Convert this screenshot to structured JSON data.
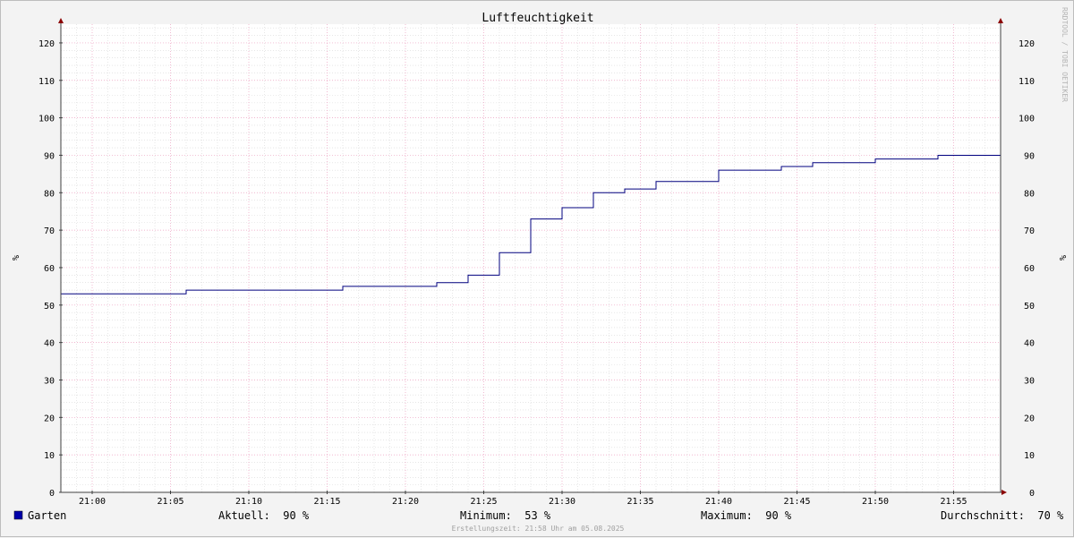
{
  "chart_data": {
    "type": "line",
    "title": "Luftfeuchtigkeit",
    "ylabel_left": "%",
    "ylabel_right": "%",
    "ylim": [
      0,
      125
    ],
    "y_major_ticks": [
      0,
      10,
      20,
      30,
      40,
      50,
      60,
      70,
      80,
      90,
      100,
      110,
      120
    ],
    "x_tick_labels": [
      "21:00",
      "21:05",
      "21:10",
      "21:15",
      "21:20",
      "21:25",
      "21:30",
      "21:35",
      "21:40",
      "21:45",
      "21:50",
      "21:55"
    ],
    "x_range": [
      "20:58",
      "21:58"
    ],
    "step": true,
    "grid": true,
    "colors": {
      "line": "#00007f",
      "legend_box": "#0000aa",
      "grid_minor": "#d8d8d8",
      "grid_major": "#ec9ebf",
      "axis": "#404040",
      "arrow": "#8b0000"
    },
    "series": [
      {
        "name": "Garten",
        "x": [
          "20:58",
          "21:06",
          "21:16",
          "21:22",
          "21:24",
          "21:26",
          "21:28",
          "21:30",
          "21:32",
          "21:34",
          "21:36",
          "21:40",
          "21:44",
          "21:46",
          "21:50",
          "21:54",
          "21:58"
        ],
        "values": [
          53,
          54,
          55,
          56,
          58,
          64,
          73,
          76,
          80,
          81,
          83,
          86,
          87,
          88,
          89,
          90,
          90
        ]
      }
    ]
  },
  "legend": {
    "series_label": "Garten",
    "current": "Aktuell:  90 %",
    "minimum": "Minimum:  53 %",
    "maximum": "Maximum:  90 %",
    "average": "Durchschnitt:  70 %"
  },
  "footer": "Erstellungszeit: 21:58 Uhr am 05.08.2025",
  "watermark": "RRDTOOL / TOBI OETIKER"
}
